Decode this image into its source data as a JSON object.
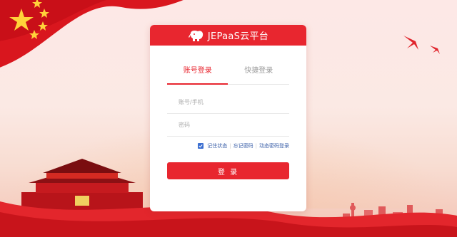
{
  "header": {
    "title": "JEPaaS云平台",
    "logo_icon": "elephant-icon"
  },
  "tabs": [
    {
      "label": "账号登录",
      "active": true
    },
    {
      "label": "快捷登录",
      "active": false
    }
  ],
  "form": {
    "username_placeholder": "账号/手机",
    "password_placeholder": "密码",
    "remember_checked": true,
    "remember_label": "记住状态",
    "forgot_label": "忘记密码",
    "dynamic_label": "动态密码登录",
    "submit_label": "登 录"
  },
  "colors": {
    "accent": "#e8262f",
    "link": "#3a5fa8",
    "checkbox": "#3c6fd1"
  }
}
